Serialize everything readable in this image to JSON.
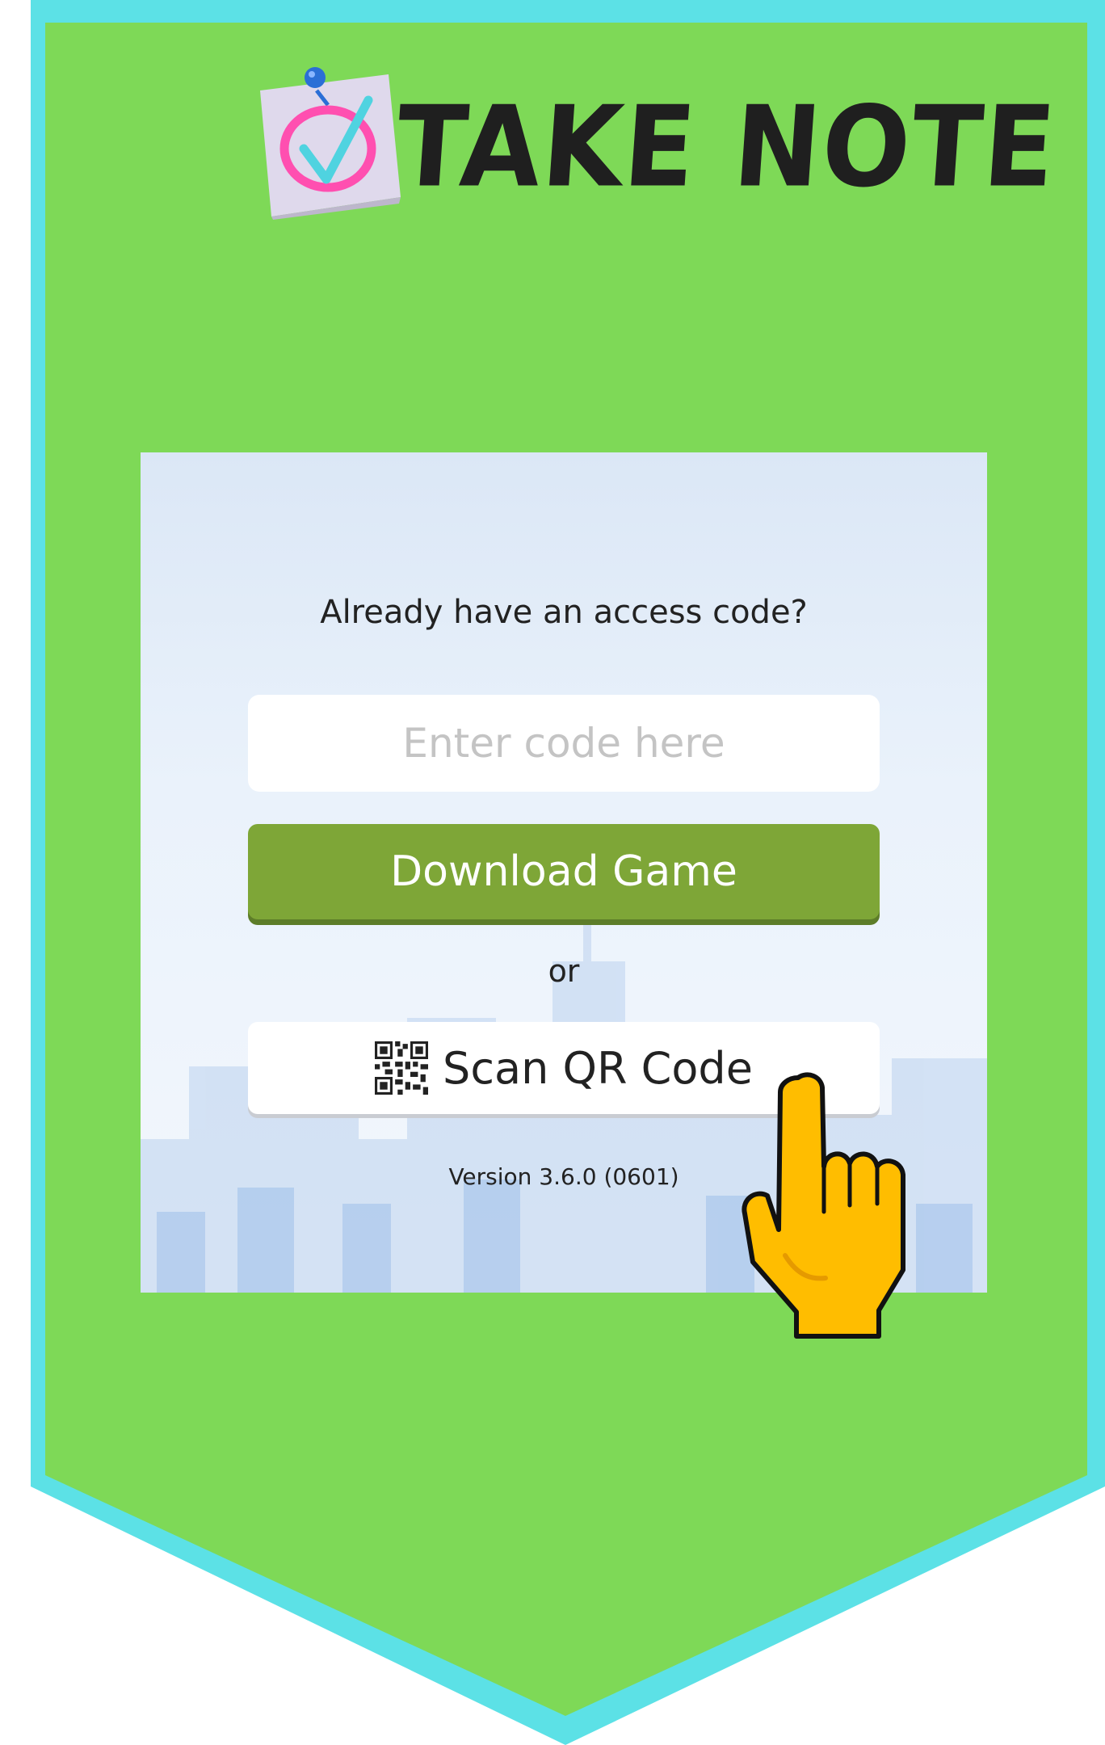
{
  "header": {
    "title": "TAKE NOTE",
    "logo_icon": "sticky-note-checkmark-icon"
  },
  "panel": {
    "prompt": "Already have an access code?",
    "code_input": {
      "placeholder": "Enter code here",
      "value": ""
    },
    "download_button": "Download Game",
    "or_text": "or",
    "scan_button": "Scan QR Code",
    "scan_icon": "qr-code-icon",
    "version": "Version 3.6.0 (0601)"
  },
  "pointer_icon": "pointing-hand-icon",
  "colors": {
    "banner_green": "#7ed957",
    "banner_border": "#5ce1e6",
    "download_green": "#7ea637",
    "hand_yellow": "#ffbd00"
  }
}
